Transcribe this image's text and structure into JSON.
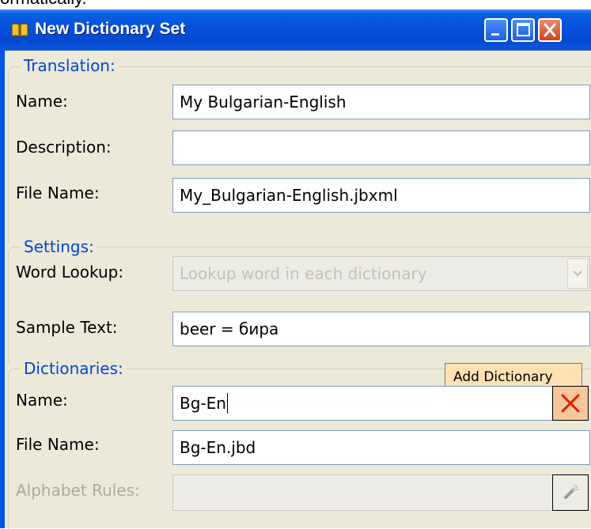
{
  "top_fragment": "ormatically.",
  "window": {
    "title": "New Dictionary Set",
    "minimize_label": "Minimize",
    "maximize_label": "Maximize",
    "close_label": "Close"
  },
  "translation": {
    "legend": "Translation:",
    "name_label": "Name:",
    "name_value": "My Bulgarian-English",
    "description_label": "Description:",
    "description_value": "",
    "file_name_label": "File Name:",
    "file_name_value": "My_Bulgarian-English.jbxml"
  },
  "settings": {
    "legend": "Settings:",
    "word_lookup_label": "Word Lookup:",
    "word_lookup_value": "Lookup word in each dictionary",
    "sample_text_label": "Sample Text:",
    "sample_text_value": "beer = бира"
  },
  "dictionaries": {
    "legend": "Dictionaries:",
    "add_tooltip": "Add Dictionary",
    "name_label": "Name:",
    "name_value": "Bg-En",
    "file_name_label": "File Name:",
    "file_name_value": "Bg-En.jbd",
    "alphabet_rules_label": "Alphabet Rules:",
    "alphabet_rules_value": ""
  },
  "icons": {
    "app": "book-icon",
    "remove": "red-x-icon",
    "wand": "magic-wand-icon"
  },
  "colors": {
    "titlebar": "#0550d8",
    "legend_text": "#0046d5",
    "window_body": "#ece9d8",
    "tooltip_bg": "#ffe1b4",
    "remove_button_bg": "#f6c79b",
    "remove_x": "#e02000"
  }
}
